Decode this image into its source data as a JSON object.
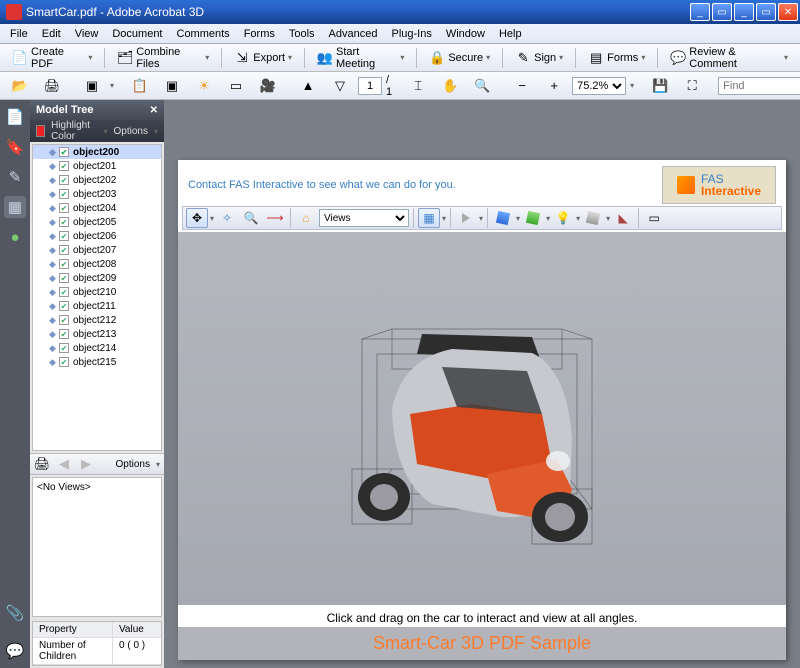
{
  "window": {
    "title": "SmartCar.pdf - Adobe Acrobat 3D"
  },
  "menu": [
    "File",
    "Edit",
    "View",
    "Document",
    "Comments",
    "Forms",
    "Tools",
    "Advanced",
    "Plug-Ins",
    "Window",
    "Help"
  ],
  "toolbar1": {
    "create": "Create PDF",
    "combine": "Combine Files",
    "export": "Export",
    "meeting": "Start Meeting",
    "secure": "Secure",
    "sign": "Sign",
    "forms": "Forms",
    "review": "Review & Comment"
  },
  "toolbar2": {
    "page_current": "1",
    "page_total": "1",
    "zoom": "75.2%",
    "find_placeholder": "Find"
  },
  "panel": {
    "title": "Model Tree",
    "highlight": "Highlight Color",
    "options": "Options",
    "noviews": "<No Views>",
    "prop_hdr1": "Property",
    "prop_hdr2": "Value",
    "prop_k": "Number of Children",
    "prop_v": "0 ( 0 )",
    "items": [
      "object200",
      "object201",
      "object202",
      "object203",
      "object204",
      "object205",
      "object206",
      "object207",
      "object208",
      "object209",
      "object210",
      "object211",
      "object212",
      "object213",
      "object214",
      "object215"
    ],
    "selected_index": 0
  },
  "page": {
    "headline": "Contact FAS Interactive to see what we can do for you.",
    "fas_t1": "FAS",
    "fas_t2": "Interactive",
    "caption": "Click and drag on the car to interact and view at all angles.",
    "sample": "Smart-Car 3D PDF Sample"
  },
  "d3": {
    "view_sel": "Views"
  }
}
